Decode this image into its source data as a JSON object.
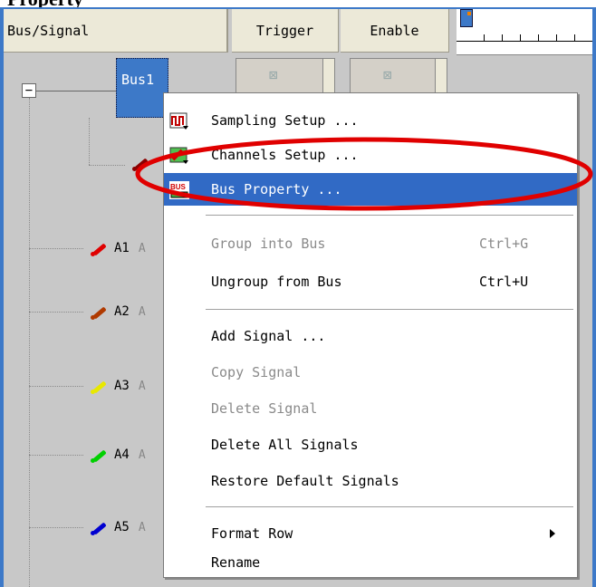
{
  "caption": "Property",
  "header": {
    "bus_signal": "Bus/Signal",
    "trigger": "Trigger",
    "enable": "Enable"
  },
  "tree": {
    "bus_label": "Bus1",
    "collapse_glyph": "−",
    "signals": [
      {
        "name": "A1",
        "ghost": "A",
        "color": "#e00000"
      },
      {
        "name": "A2",
        "ghost": "A",
        "color": "#b03a00"
      },
      {
        "name": "A3",
        "ghost": "A",
        "color": "#e8e800"
      },
      {
        "name": "A4",
        "ghost": "A",
        "color": "#00d000"
      },
      {
        "name": "A5",
        "ghost": "A",
        "color": "#0000d0"
      }
    ]
  },
  "menu": {
    "items": [
      {
        "label": "Sampling Setup ...",
        "icon": "sampling-icon"
      },
      {
        "label": "Channels Setup ...",
        "icon": "channels-icon"
      },
      {
        "label": "Bus Property ...",
        "icon": "bus-icon",
        "icon_text": "BUS",
        "highlighted": true
      },
      {
        "label": "Group into Bus",
        "shortcut": "Ctrl+G",
        "disabled": true
      },
      {
        "label": "Ungroup from Bus",
        "shortcut": "Ctrl+U"
      },
      {
        "label": "Add Signal ..."
      },
      {
        "label": "Copy Signal",
        "disabled": true
      },
      {
        "label": "Delete Signal",
        "disabled": true
      },
      {
        "label": "Delete All Signals"
      },
      {
        "label": "Restore Default Signals"
      },
      {
        "label": "Format Row",
        "submenu": true
      },
      {
        "label": "Rename"
      }
    ]
  },
  "colors": {
    "selection": "#316ac5",
    "annotation": "#e00000",
    "frame": "#3d79c8"
  }
}
